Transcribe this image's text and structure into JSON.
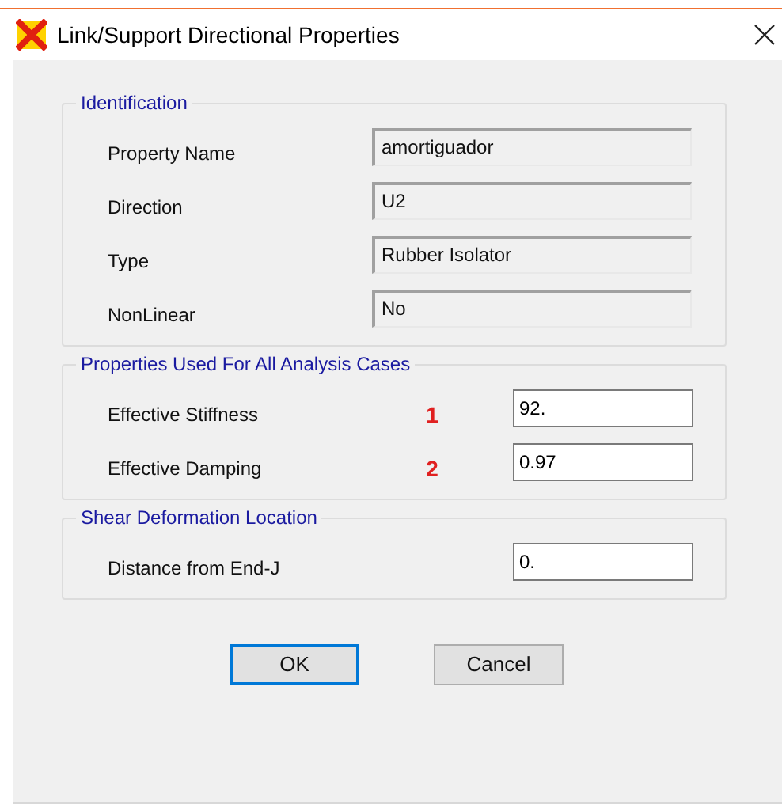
{
  "window": {
    "title": "Link/Support Directional Properties"
  },
  "groups": [
    {
      "title": "Identification",
      "rows": [
        {
          "kind": "readonly",
          "label": "Property Name",
          "value": "amortiguador"
        },
        {
          "kind": "readonly",
          "label": "Direction",
          "value": "U2"
        },
        {
          "kind": "readonly",
          "label": "Type",
          "value": "Rubber Isolator"
        },
        {
          "kind": "readonly",
          "label": "NonLinear",
          "value": "No"
        }
      ]
    },
    {
      "title": "Properties Used For All Analysis Cases",
      "rows": [
        {
          "kind": "input",
          "label": "Effective Stiffness",
          "marker": "1",
          "value": "92."
        },
        {
          "kind": "input",
          "label": "Effective Damping",
          "marker": "2",
          "value": "0.97"
        }
      ]
    },
    {
      "title": "Shear Deformation Location",
      "rows": [
        {
          "kind": "input",
          "label": "Distance from End-J",
          "value": "0."
        }
      ]
    }
  ],
  "buttons": [
    {
      "label": "OK",
      "selected": true
    },
    {
      "label": "Cancel",
      "selected": false
    }
  ]
}
